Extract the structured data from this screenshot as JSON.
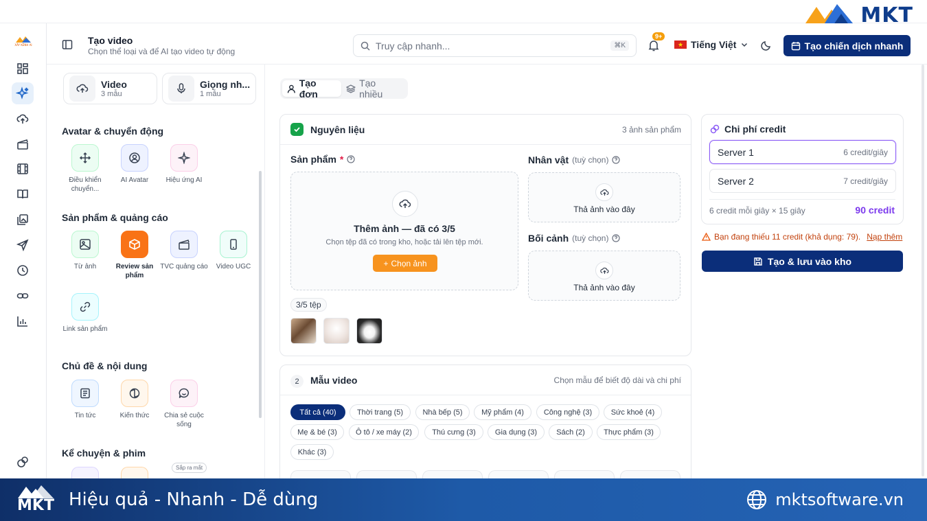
{
  "brand": {
    "logo_text": "MKT",
    "rail_brand": "XÂY KÊNH AI"
  },
  "header": {
    "title": "Tạo video",
    "subtitle": "Chọn thể loại và để AI tạo video tự động",
    "search_placeholder": "Truy cập nhanh...",
    "search_kbd": "⌘K",
    "notif_badge": "9+",
    "language": "Tiếng Việt",
    "campaign_button": "Tạo chiến dịch nhanh"
  },
  "left": {
    "cards": [
      {
        "title": "Video",
        "sub": "3 mẫu"
      },
      {
        "title": "Giọng nh...",
        "sub": "1 mẫu"
      }
    ],
    "sections": [
      {
        "title": "Avatar & chuyển động",
        "items": [
          "Điều khiển chuyển...",
          "AI Avatar",
          "Hiệu ứng AI"
        ]
      },
      {
        "title": "Sản phẩm & quảng cáo",
        "items": [
          "Từ ảnh",
          "Review sản phẩm",
          "TVC quảng cáo",
          "Video UGC",
          "Link sản phẩm"
        ]
      },
      {
        "title": "Chủ đề & nội dung",
        "items": [
          "Tin tức",
          "Kiến thức",
          "Chia sẻ cuộc sống"
        ]
      },
      {
        "title": "Kể chuyện & phim",
        "items": []
      }
    ],
    "soon_badge": "Sắp ra mắt"
  },
  "mode_tabs": [
    "Tạo đơn",
    "Tạo nhiều"
  ],
  "materials": {
    "title": "Nguyên liệu",
    "right": "3 ảnh sản phẩm",
    "product_label": "Sản phẩm",
    "required_mark": "*",
    "drop_title": "Thêm ảnh — đã có 3/5",
    "drop_sub": "Chọn tệp đã có trong kho, hoặc tải lên tệp mới.",
    "choose_btn": "Chọn ảnh",
    "file_count": "3/5 tệp",
    "character_label": "Nhân vật",
    "background_label": "Bối cảnh",
    "optional": "(tuỳ chọn)",
    "drop_here": "Thả ảnh vào đây"
  },
  "templates": {
    "step": "2",
    "title": "Mẫu video",
    "right": "Chọn mẫu để biết độ dài và chi phí",
    "chips": [
      "Tất cả (40)",
      "Thời trang (5)",
      "Nhà bếp (5)",
      "Mỹ phẩm (4)",
      "Công nghệ (3)",
      "Sức khoẻ (4)",
      "Mẹ & bé (3)",
      "Ô tô / xe máy (2)",
      "Thú cưng (3)",
      "Gia dụng (3)",
      "Sách (2)",
      "Thực phẩm (3)",
      "Khác (3)"
    ]
  },
  "credit": {
    "title": "Chi phí credit",
    "servers": [
      {
        "name": "Server 1",
        "price": "6 credit/giây"
      },
      {
        "name": "Server 2",
        "price": "7 credit/giây"
      }
    ],
    "formula": "6 credit mỗi giây × 15 giây",
    "total": "90 credit",
    "warning": "Bạn đang thiếu 11 credit (khả dụng: 79).",
    "topup": "Nạp thêm",
    "save_btn": "Tạo & lưu vào kho"
  },
  "footer": {
    "logo": "MKT",
    "slogan": "Hiệu quả - Nhanh - Dễ dùng",
    "website": "mktsoftware.vn"
  },
  "colors": {
    "primary": "#0b2e7a",
    "accent": "#f7931e",
    "success": "#16a34a",
    "credit": "#7c3aed"
  }
}
